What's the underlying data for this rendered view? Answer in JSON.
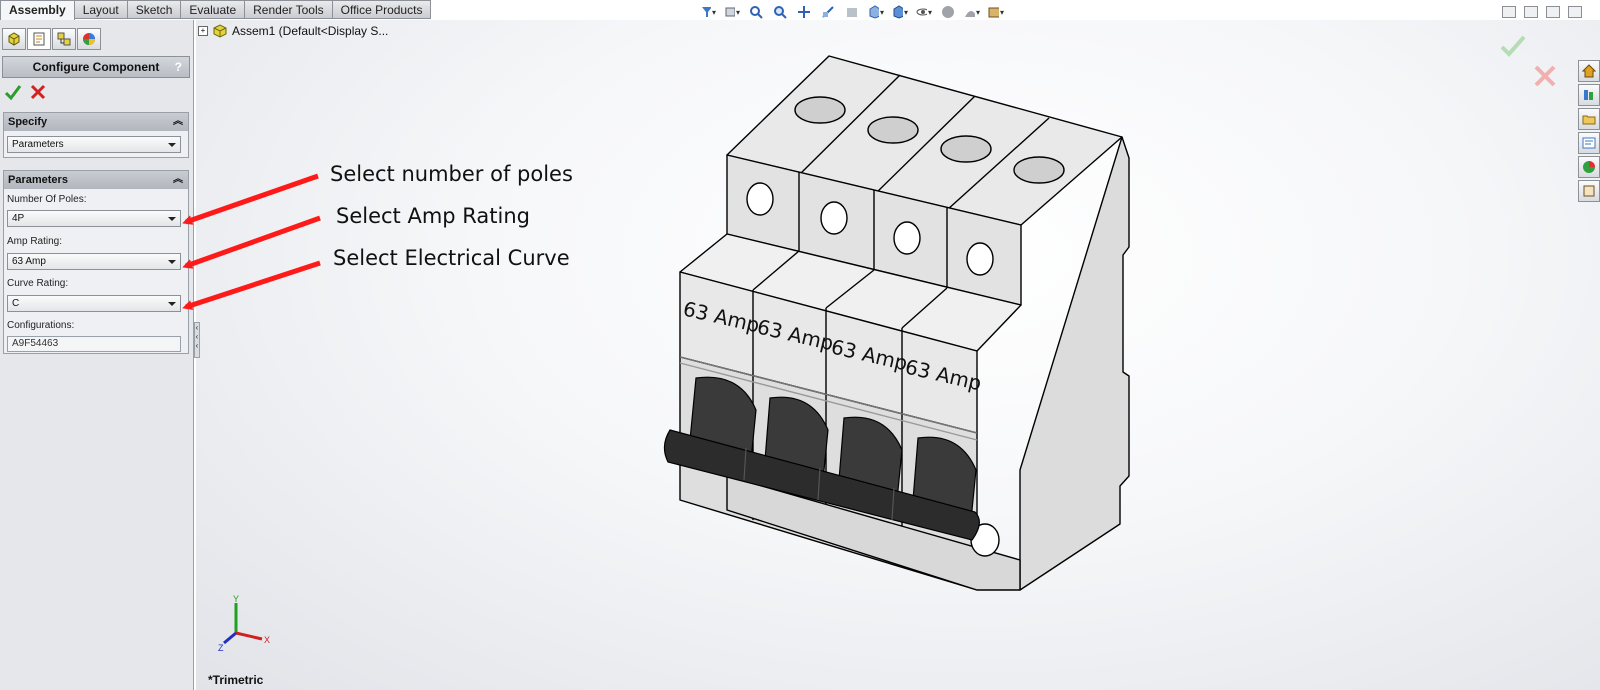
{
  "command_tabs": [
    "Assembly",
    "Layout",
    "Sketch",
    "Evaluate",
    "Render Tools",
    "Office Products"
  ],
  "active_tab": "Assembly",
  "property_manager": {
    "title": "Configure Component",
    "help": "?",
    "specify": {
      "heading": "Specify",
      "selected": "Parameters"
    },
    "parameters": {
      "heading": "Parameters",
      "poles_label": "Number Of Poles:",
      "poles_value": "4P",
      "amp_label": "Amp Rating:",
      "amp_value": "63 Amp",
      "curve_label": "Curve Rating:",
      "curve_value": "C",
      "config_label": "Configurations:",
      "config_value": "A9F54463"
    }
  },
  "tree": {
    "root": "Assem1  (Default<Display S..."
  },
  "annotations": {
    "poles": "Select number of poles",
    "amp": "Select Amp Rating",
    "curve": "Select Electrical Curve"
  },
  "model": {
    "pole_label": "63 Amp",
    "pole_count": 4
  },
  "view": {
    "name": "*Trimetric",
    "axis_x": "X",
    "axis_y": "Y",
    "axis_z": "Z"
  },
  "colors": {
    "accent_red": "#ff1a1a",
    "ok_green": "#2a9d2a",
    "cancel_red": "#d42020"
  }
}
